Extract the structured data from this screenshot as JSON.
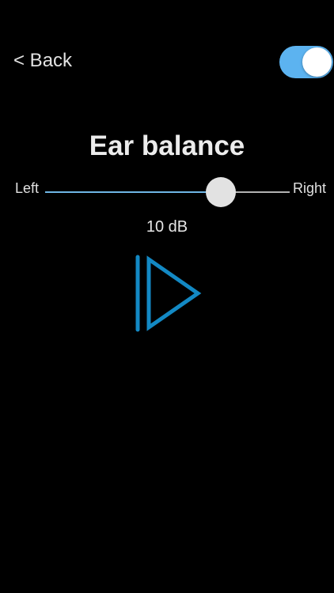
{
  "header": {
    "back_label": "< Back",
    "toggle": {
      "on": true,
      "color": "#5cb3f0"
    }
  },
  "main": {
    "title": "Ear balance",
    "slider": {
      "left_label": "Left",
      "right_label": "Right",
      "value_fraction": 0.72,
      "fill_color": "#6fb6e6"
    },
    "value_readout": "10 dB",
    "play_icon": "play-icon",
    "accent_color": "#1389c4"
  }
}
